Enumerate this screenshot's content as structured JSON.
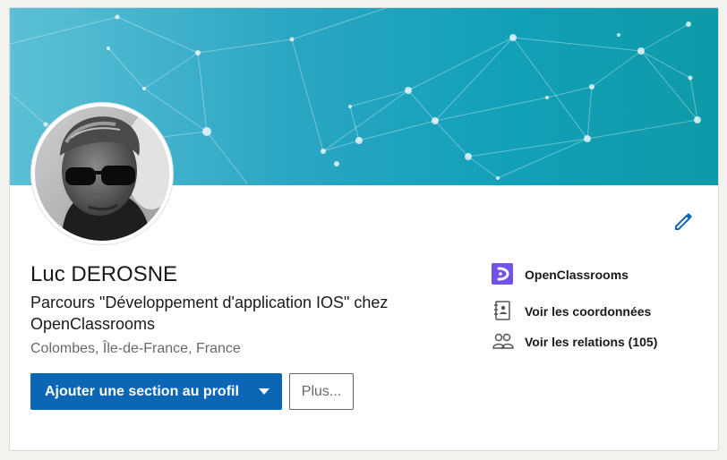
{
  "profile": {
    "name": "Luc DEROSNE",
    "headline": "Parcours \"Développement d'application IOS\" chez OpenClassrooms",
    "location": "Colombes, Île-de-France, France"
  },
  "actions": {
    "primary_label": "Ajouter une section au profil",
    "more_label": "Plus..."
  },
  "side": {
    "company": "OpenClassrooms",
    "contact": "Voir les coordonnées",
    "relations": "Voir les relations (105)"
  },
  "icons": {
    "edit": "pencil-icon",
    "company_logo": "openclassrooms-logo-icon",
    "contact": "address-book-icon",
    "relations": "people-icon",
    "caret": "caret-down-icon"
  },
  "colors": {
    "accent": "#0b66b6",
    "banner_start": "#5cc0d6",
    "banner_end": "#0f9aa8",
    "openclassrooms": "#7451eb"
  }
}
